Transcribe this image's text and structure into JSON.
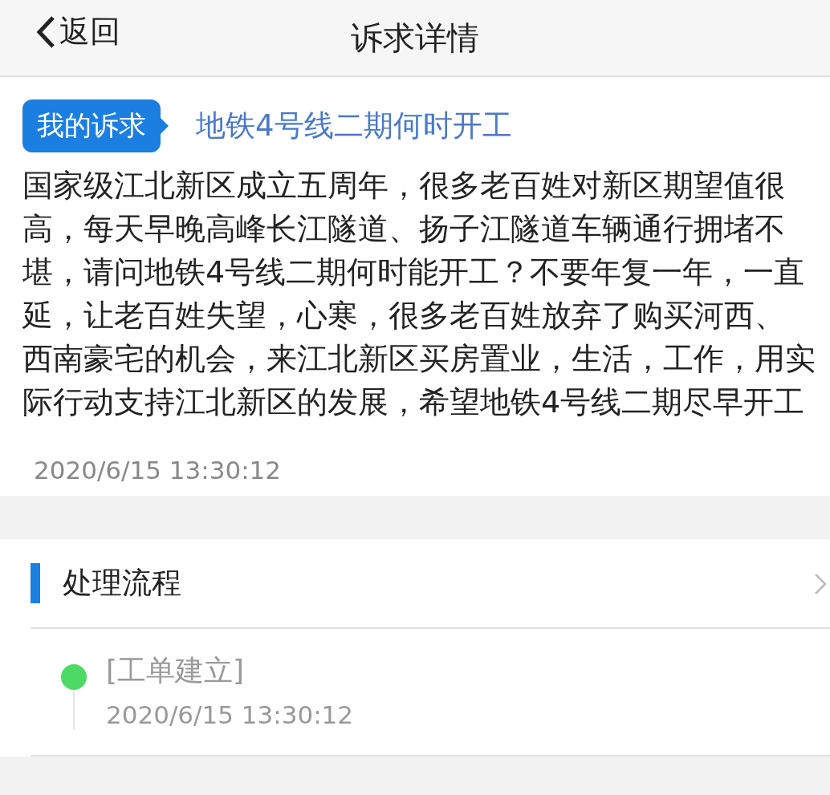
{
  "nav": {
    "back": "返回",
    "title": "诉求详情"
  },
  "appeal": {
    "tag": "我的诉求",
    "subject": "地铁4号线二期何时开工",
    "body_lines": [
      "国家级江北新区成立五周年，很多老百姓对新区期望值很",
      "高，每天早晚高峰长江隧道、扬子江隧道车辆通行拥堵不",
      "堪，请问地铁4号线二期何时能开工？不要年复一年，一直",
      "延，让老百姓失望，心寒，很多老百姓放弃了购买河西、",
      "西南豪宅的机会，来江北新区买房置业，生活，工作，用实",
      "际行动支持江北新区的发展，希望地铁4号线二期尽早开工"
    ],
    "time": "2020/6/15 13:30:12"
  },
  "process": {
    "title": "处理流程",
    "steps": [
      {
        "label": "[工单建立]",
        "time": "2020/6/15 13:30:12",
        "color": "#4cd964"
      }
    ]
  }
}
